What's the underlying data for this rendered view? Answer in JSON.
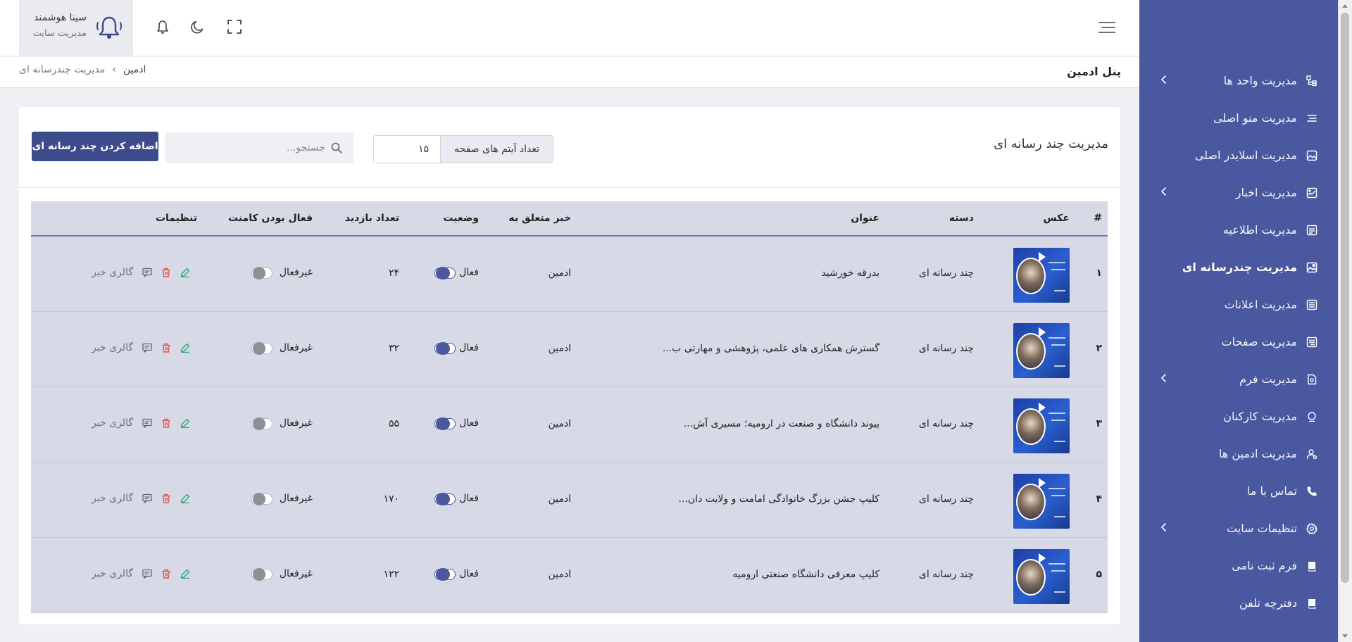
{
  "user": {
    "name": "سینا هوشمند",
    "role": "مدیریت سایت"
  },
  "breadcrumb": {
    "panel_title": "پنل ادمین",
    "items": [
      "مدیریت چندرسانه ای",
      "ادمین"
    ]
  },
  "sidebar": {
    "items": [
      {
        "label": "مدیریت واحد ها",
        "icon": "units-icon",
        "has_submenu": true,
        "active": false
      },
      {
        "label": "مدیریت منو اصلی",
        "icon": "menu-list-icon",
        "has_submenu": false,
        "active": false
      },
      {
        "label": "مدیریت اسلایدر اصلی",
        "icon": "image-icon",
        "has_submenu": false,
        "active": false
      },
      {
        "label": "مدیریت اخبار",
        "icon": "news-icon",
        "has_submenu": true,
        "active": false
      },
      {
        "label": "مدیریت اطلاعیه",
        "icon": "notice-icon",
        "has_submenu": false,
        "active": false
      },
      {
        "label": "مدیریت چندرسانه ای",
        "icon": "multimedia-icon",
        "has_submenu": false,
        "active": true
      },
      {
        "label": "مدیریت اعلانات",
        "icon": "announcement-icon",
        "has_submenu": false,
        "active": false
      },
      {
        "label": "مدیریت صفحات",
        "icon": "pages-icon",
        "has_submenu": false,
        "active": false
      },
      {
        "label": "مدیریت فرم",
        "icon": "form-icon",
        "has_submenu": true,
        "active": false
      },
      {
        "label": "مدیریت کارکنان",
        "icon": "staff-icon",
        "has_submenu": false,
        "active": false
      },
      {
        "label": "مدیریت ادمین ها",
        "icon": "admin-user-icon",
        "has_submenu": false,
        "active": false
      },
      {
        "label": "تماس با ما",
        "icon": "phone-icon",
        "has_submenu": false,
        "active": false
      },
      {
        "label": "تنظیمات سایت",
        "icon": "gear-icon",
        "has_submenu": true,
        "active": false
      },
      {
        "label": "فرم ثبت نامی",
        "icon": "register-book-icon",
        "has_submenu": false,
        "active": false
      },
      {
        "label": "دفترچه تلفن",
        "icon": "phonebook-icon",
        "has_submenu": false,
        "active": false
      }
    ]
  },
  "page": {
    "title": "مدیریت چند رسانه ای",
    "per_page_label": "تعداد آیتم های صفحه",
    "per_page_value": "۱۵",
    "search_placeholder": "جستجو...",
    "add_button": "اضافه کردن چند رسانه ای"
  },
  "table": {
    "headers": {
      "index": "#",
      "photo": "عکس",
      "category": "دسته",
      "title": "عنوان",
      "related_news": "خبر متعلق به",
      "status": "وضعیت",
      "views": "تعداد بازدید",
      "comments_active": "فعال بودن کامنت",
      "settings": "تنظیمات"
    },
    "rows": [
      {
        "index": "۱",
        "category": "چند رسانه ای",
        "title": "بدرقه خورشید",
        "related_news": "ادمین",
        "status": "فعال",
        "status_on": true,
        "views": "۲۴",
        "comments": "غیرفعال",
        "comments_on": false,
        "gallery": "گالری خبر"
      },
      {
        "index": "۲",
        "category": "چند رسانه ای",
        "title": "گسترش همکاری های علمی، پژوهشی و مهارتی ب...",
        "related_news": "ادمین",
        "status": "فعال",
        "status_on": true,
        "views": "۳۲",
        "comments": "غیرفعال",
        "comments_on": false,
        "gallery": "گالری خبر"
      },
      {
        "index": "۳",
        "category": "چند رسانه ای",
        "title": "پیوند دانشگاه و صنعت در ارومیه؛ مسیری آش...",
        "related_news": "ادمین",
        "status": "فعال",
        "status_on": true,
        "views": "۵۵",
        "comments": "غیرفعال",
        "comments_on": false,
        "gallery": "گالری خبر"
      },
      {
        "index": "۴",
        "category": "چند رسانه ای",
        "title": "کلیپ جشن بزرگ خانوادگی امامت و ولایت دان...",
        "related_news": "ادمین",
        "status": "فعال",
        "status_on": true,
        "views": "۱۷۰",
        "comments": "غیرفعال",
        "comments_on": false,
        "gallery": "گالری خبر"
      },
      {
        "index": "۵",
        "category": "چند رسانه ای",
        "title": "کلیپ معرفی دانشگاه صنعتی ارومیه",
        "related_news": "ادمین",
        "status": "فعال",
        "status_on": true,
        "views": "۱۲۲",
        "comments": "غیرفعال",
        "comments_on": false,
        "gallery": "گالری خبر"
      }
    ]
  },
  "colors": {
    "sidebar_bg": "#4a58a0",
    "primary": "#3d4a8c",
    "edit": "#2aa876",
    "delete": "#e0564f",
    "table_row": "#d7dae6"
  }
}
